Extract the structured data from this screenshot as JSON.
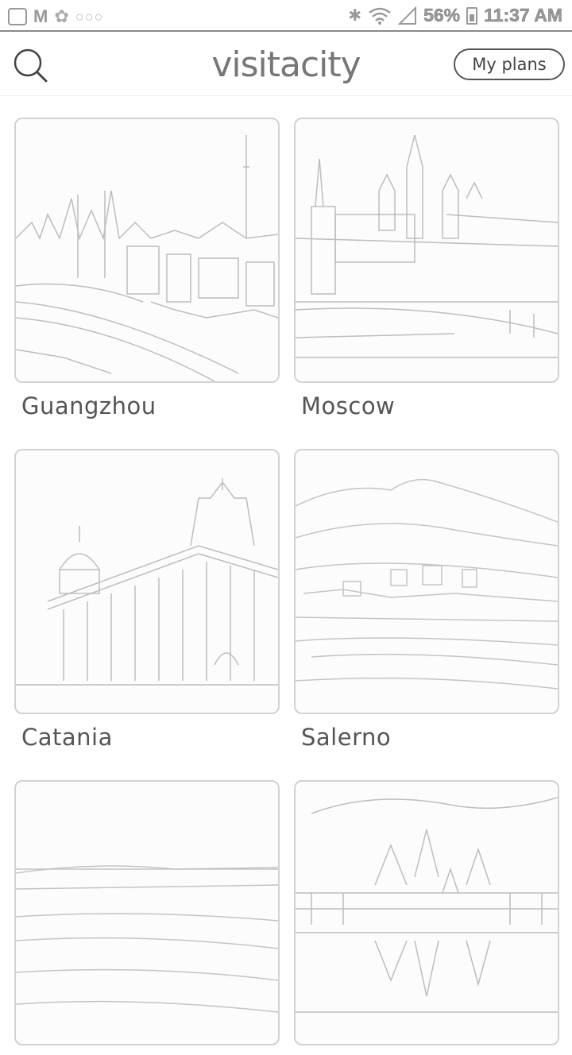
{
  "status_bar": {
    "battery": "56%",
    "time": "11:37 AM",
    "icons": [
      "gallery-icon",
      "gmail-icon",
      "flower-icon",
      "more-dots-icon",
      "bluetooth-icon",
      "wifi-icon",
      "signal-icon",
      "battery-icon"
    ]
  },
  "header": {
    "logo": "visitacity",
    "my_plans": "My plans",
    "search_icon": "search-icon"
  },
  "cities": [
    {
      "name": "Guangzhou"
    },
    {
      "name": "Moscow"
    },
    {
      "name": "Catania"
    },
    {
      "name": "Salerno"
    },
    {
      "name": ""
    },
    {
      "name": ""
    }
  ]
}
